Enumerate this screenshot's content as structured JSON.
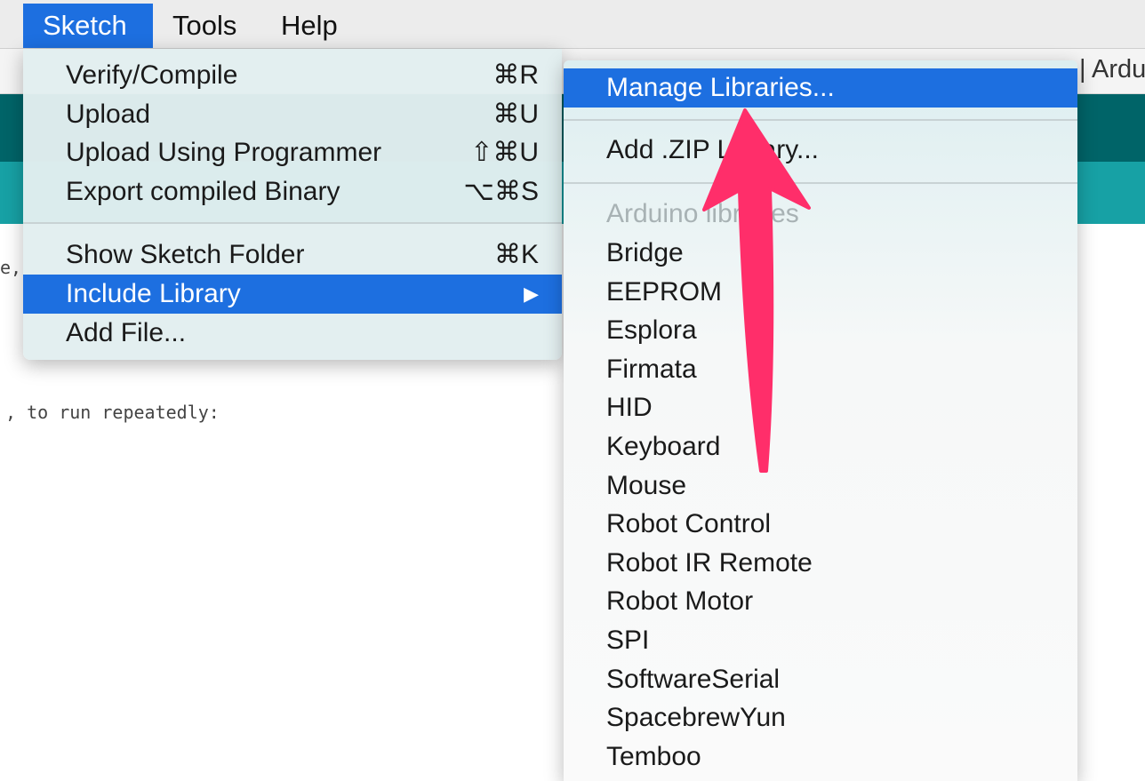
{
  "menubar": {
    "sketch": "Sketch",
    "tools": "Tools",
    "help": "Help"
  },
  "window": {
    "title_fragment": "| Ardu"
  },
  "editor": {
    "line1": "e,",
    "line2": ", to run repeatedly:"
  },
  "sketch_menu": {
    "verify": {
      "label": "Verify/Compile",
      "shortcut": "⌘R"
    },
    "upload": {
      "label": "Upload",
      "shortcut": "⌘U"
    },
    "upload_programmer": {
      "label": "Upload Using Programmer",
      "shortcut": "⇧⌘U"
    },
    "export_binary": {
      "label": "Export compiled Binary",
      "shortcut": "⌥⌘S"
    },
    "show_folder": {
      "label": "Show Sketch Folder",
      "shortcut": "⌘K"
    },
    "include_library": {
      "label": "Include Library",
      "submenu_glyph": "▶"
    },
    "add_file": {
      "label": "Add File..."
    }
  },
  "library_menu": {
    "manage": "Manage Libraries...",
    "add_zip": "Add .ZIP Library...",
    "section_header": "Arduino libraries",
    "libraries": [
      "Bridge",
      "EEPROM",
      "Esplora",
      "Firmata",
      "HID",
      "Keyboard",
      "Mouse",
      "Robot Control",
      "Robot IR Remote",
      "Robot Motor",
      "SPI",
      "SoftwareSerial",
      "SpacebrewYun",
      "Temboo"
    ]
  },
  "annotation": {
    "arrow_color": "#ff2e6a"
  },
  "colors": {
    "highlight": "#1d6fe0",
    "teal_dark": "#006468",
    "teal_light": "#17a1a5"
  }
}
